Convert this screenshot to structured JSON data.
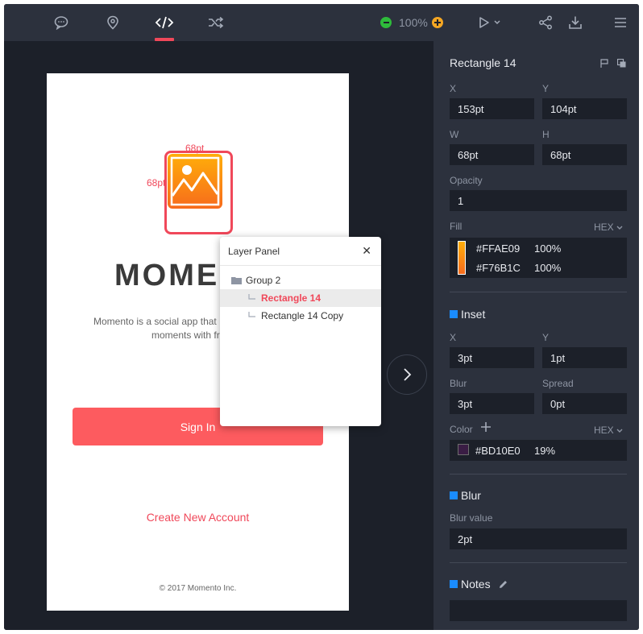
{
  "toolbar": {
    "icons": [
      "comment-icon",
      "location-pin-icon",
      "code-icon",
      "shuffle-icon",
      "play-icon",
      "share-icon",
      "download-icon",
      "menu-icon"
    ],
    "zoom_value": "100%",
    "zoom_minus": "–",
    "zoom_plus": "+"
  },
  "artboard": {
    "width_dim": "68pt",
    "height_dim": "68pt",
    "brand": "MOMENTO",
    "description_line1": "Momento is a social app that",
    "description_line2": "moments with fr",
    "sign_in": "Sign In",
    "create_account": "Create New Account",
    "copyright": "© 2017 Momento Inc."
  },
  "layer_panel": {
    "title": "Layer Panel",
    "close": "✕",
    "items": [
      {
        "label": "Group 2",
        "type": "folder"
      },
      {
        "label": "Rectangle 14",
        "type": "layer",
        "selected": true
      },
      {
        "label": "Rectangle 14 Copy",
        "type": "layer"
      }
    ]
  },
  "inspector": {
    "title": "Rectangle 14",
    "x_label": "X",
    "x_value": "153pt",
    "y_label": "Y",
    "y_value": "104pt",
    "w_label": "W",
    "w_value": "68pt",
    "h_label": "H",
    "h_value": "68pt",
    "opacity_label": "Opacity",
    "opacity_value": "1",
    "fill_label": "Fill",
    "hex_label": "HEX",
    "fill_stops": [
      {
        "color": "#FFAE09",
        "percent": "100%"
      },
      {
        "color": "#F76B1C",
        "percent": "100%"
      }
    ],
    "inset": {
      "title": "Inset",
      "x_label": "X",
      "x_value": "3pt",
      "y_label": "Y",
      "y_value": "1pt",
      "blur_label": "Blur",
      "blur_value": "3pt",
      "spread_label": "Spread",
      "spread_value": "0pt",
      "color_label": "Color",
      "color_value": "#BD10E0",
      "color_percent": "19%"
    },
    "blur": {
      "title": "Blur",
      "value_label": "Blur value",
      "value": "2pt"
    },
    "notes": {
      "title": "Notes",
      "value": ""
    }
  },
  "colors": {
    "accent": "#f0485a",
    "toolbar_bg": "#2c313d",
    "canvas_bg": "#1c2029",
    "section_marker": "#1a8cff"
  }
}
